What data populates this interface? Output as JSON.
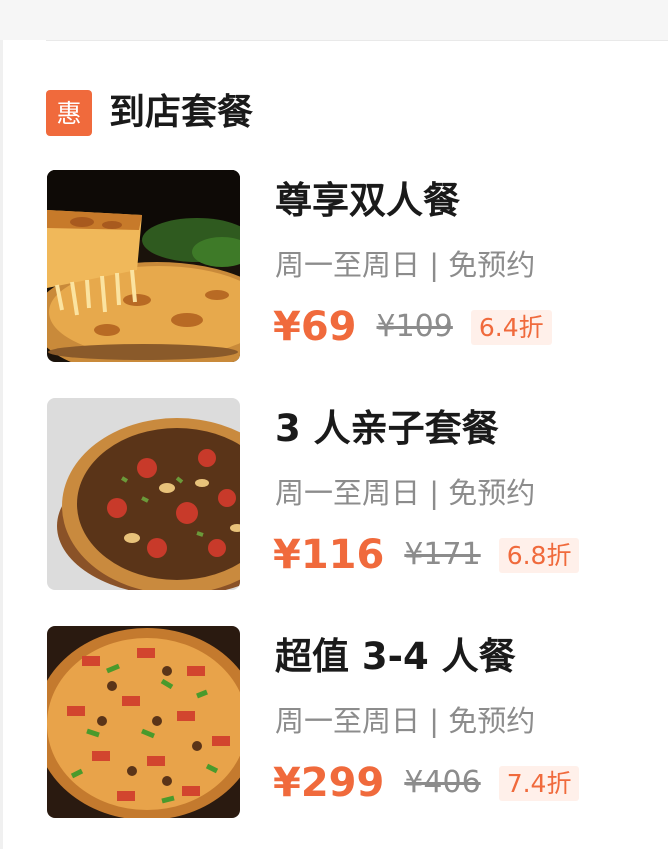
{
  "section": {
    "badge": "惠",
    "title": "到店套餐"
  },
  "deals": [
    {
      "name": "尊享双人餐",
      "meta": "周一至周日 | 免预约",
      "price": "¥69",
      "original_price": "¥109",
      "discount": "6.4折"
    },
    {
      "name": "3 人亲子套餐",
      "meta": "周一至周日 | 免预约",
      "price": "¥116",
      "original_price": "¥171",
      "discount": "6.8折"
    },
    {
      "name": "超值 3-4 人餐",
      "meta": "周一至周日 | 免预约",
      "price": "¥299",
      "original_price": "¥406",
      "discount": "7.4折"
    }
  ],
  "colors": {
    "accent": "#f06a3c",
    "discount_bg": "#fff0ea",
    "text_primary": "#1a1a1a",
    "text_secondary": "#8c8c8c"
  },
  "icons": {
    "badge": "hui-discount-icon"
  }
}
